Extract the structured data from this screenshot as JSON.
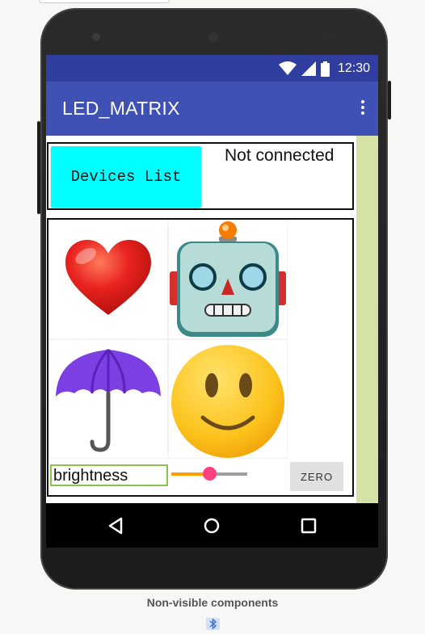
{
  "status_bar": {
    "time": "12:30"
  },
  "app_bar": {
    "title": "LED_MATRIX",
    "menu_icon": "more-vert-icon"
  },
  "connection": {
    "devices_button_label": "Devices List",
    "status_text": "Not connected"
  },
  "emoji_grid": [
    {
      "name": "heart",
      "icon": "heart-icon"
    },
    {
      "name": "robot",
      "icon": "robot-icon"
    },
    {
      "name": "umbrella",
      "icon": "umbrella-icon"
    },
    {
      "name": "smiley",
      "icon": "smiley-icon"
    }
  ],
  "controls": {
    "brightness_value": "brightness",
    "slider_level": 0.5,
    "zero_button_label": "ZERO"
  },
  "footer": {
    "label": "Non-visible components",
    "component_icon": "bluetooth-icon"
  },
  "colors": {
    "status_bar": "#303f9f",
    "app_bar": "#3f51b5",
    "devices_button": "#00ffff",
    "slider_active": "#ffa000",
    "slider_thumb": "#ff4081",
    "input_border": "#8bc34a"
  }
}
